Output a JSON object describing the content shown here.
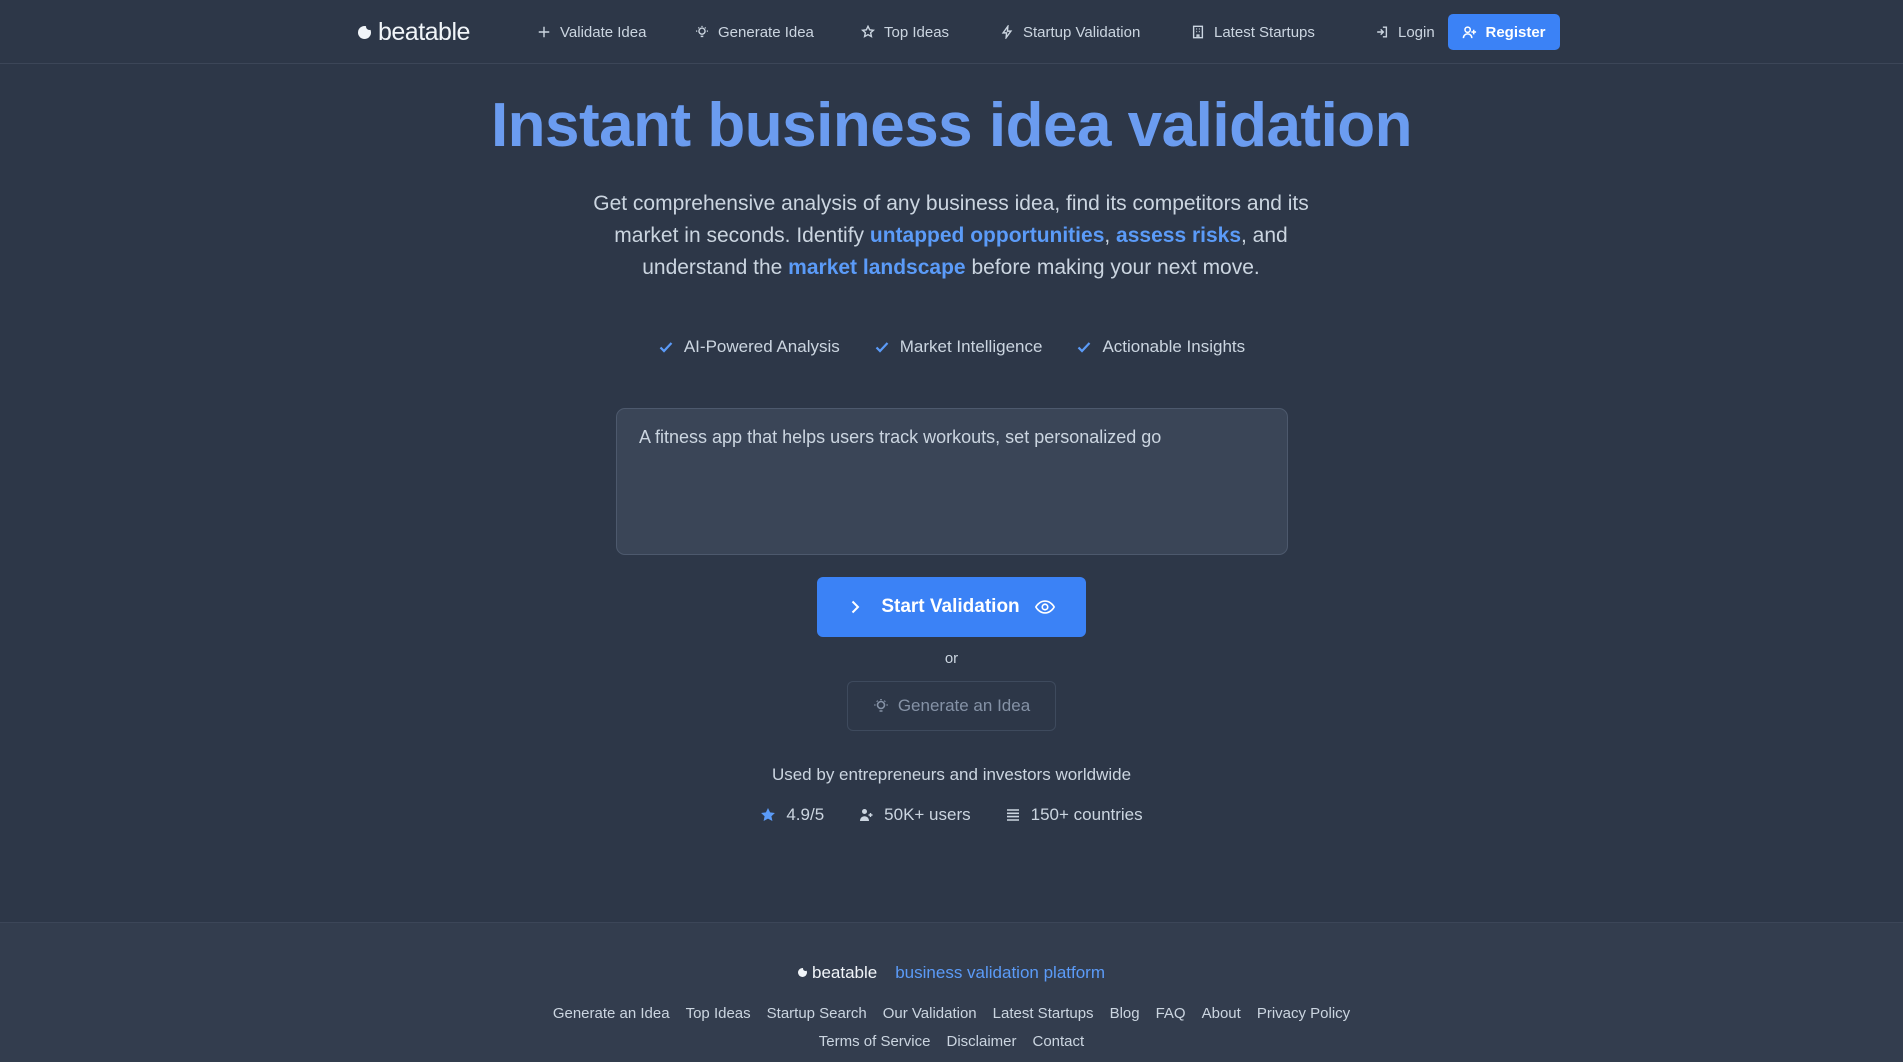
{
  "nav": {
    "brand": "beatable",
    "items": [
      {
        "label": "Validate Idea",
        "icon": "plus-icon"
      },
      {
        "label": "Generate Idea",
        "icon": "lightbulb-icon"
      },
      {
        "label": "Top Ideas",
        "icon": "star-icon"
      },
      {
        "label": "Startup Validation",
        "icon": "bolt-icon"
      },
      {
        "label": "Latest Startups",
        "icon": "building-icon"
      }
    ],
    "login": "Login",
    "register": "Register"
  },
  "hero": {
    "title": "Instant business idea validation",
    "sub_1": "Get comprehensive analysis of any business idea, find its competitors and its market in seconds. Identify ",
    "hl_1": "untapped opportunities",
    "sep_1": ", ",
    "hl_2": "assess risks",
    "sub_2": ", and understand the ",
    "hl_3": "market landscape",
    "sub_3": " before making your next move."
  },
  "features": [
    "AI-Powered Analysis",
    "Market Intelligence",
    "Actionable Insights"
  ],
  "idea_input": {
    "value": "A fitness app that helps users track workouts, set personalized go"
  },
  "actions": {
    "start": "Start Validation",
    "or": "or",
    "generate": "Generate an Idea"
  },
  "social_proof": {
    "used_by": "Used by entrepreneurs and investors worldwide",
    "rating": "4.9/5",
    "users": "50K+ users",
    "countries": "150+ countries"
  },
  "footer": {
    "brand": "beatable",
    "tagline": "business validation platform",
    "links_row1": [
      "Generate an Idea",
      "Top Ideas",
      "Startup Search",
      "Our Validation",
      "Latest Startups",
      "Blog",
      "FAQ",
      "About",
      "Privacy Policy"
    ],
    "links_row2": [
      "Terms of Service",
      "Disclaimer",
      "Contact"
    ]
  },
  "colors": {
    "background": "#2d3748",
    "accent": "#3b82f6",
    "title": "#6b9cf0",
    "highlight": "#5b9bf8"
  }
}
